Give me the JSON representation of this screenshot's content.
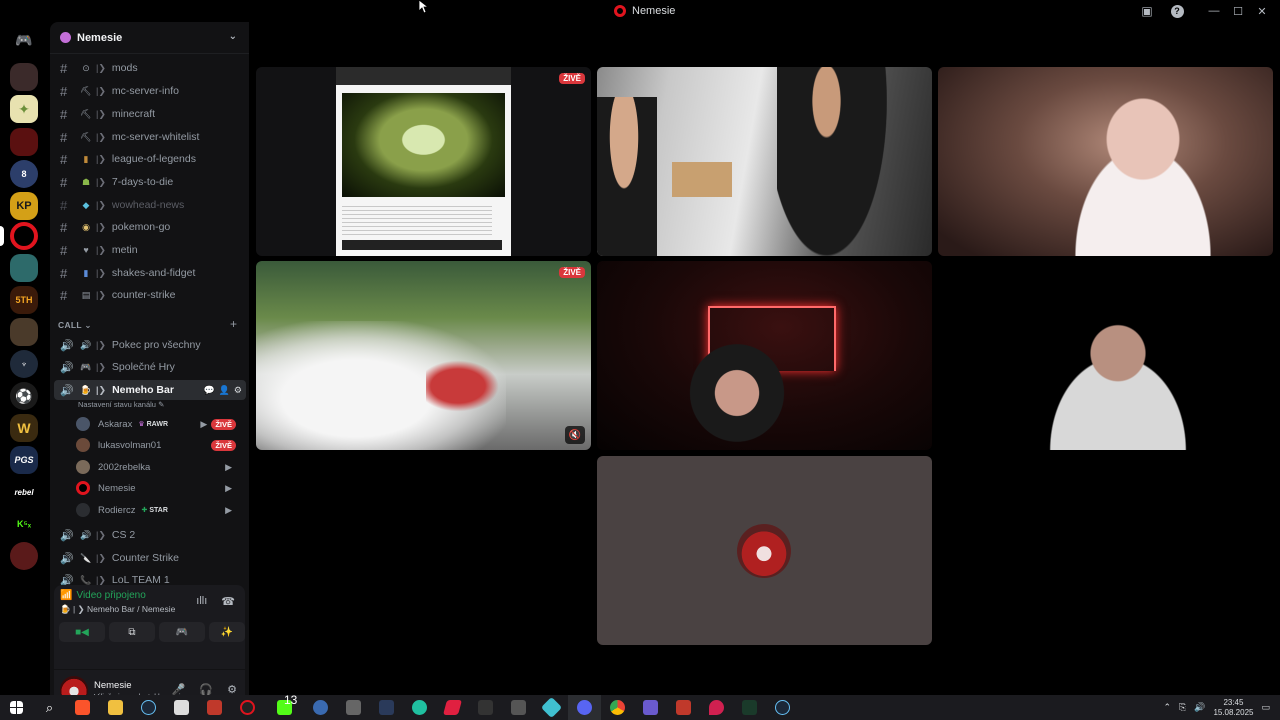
{
  "window": {
    "title": "Nemesie"
  },
  "server": {
    "name": "Nemesie"
  },
  "text_channels": [
    {
      "icon": "⊙",
      "name": "mods"
    },
    {
      "icon": "⛏",
      "name": "mc-server-info"
    },
    {
      "icon": "⛏",
      "name": "minecraft"
    },
    {
      "icon": "⛏",
      "name": "mc-server-whitelist"
    },
    {
      "icon": "▮",
      "name": "league-of-legends"
    },
    {
      "icon": "☗",
      "name": "7-days-to-die"
    },
    {
      "icon": "◆",
      "name": "wowhead-news"
    },
    {
      "icon": "◉",
      "name": "pokemon-go"
    },
    {
      "icon": "♥",
      "name": "metin"
    },
    {
      "icon": "▮",
      "name": "shakes-and-fidget"
    },
    {
      "icon": "▤",
      "name": "counter-strike"
    }
  ],
  "category": {
    "name": "CALL",
    "add": "+"
  },
  "voice_channels_top": [
    {
      "name": "Pokec pro všechny"
    },
    {
      "name": "Společné Hry"
    }
  ],
  "active_voice": {
    "name": "Nemeho Bar",
    "status": "Nastavení stavu kanálu"
  },
  "members": [
    {
      "name": "Askarax",
      "tag": "RAWR",
      "live": "ŽIVĚ",
      "color": "#4a5568"
    },
    {
      "name": "lukasvolman01",
      "tag": "",
      "live": "ŽIVĚ",
      "color": "#6b4a3a"
    },
    {
      "name": "2002rebelka",
      "tag": "",
      "live": "",
      "color": "#7a6a5a"
    },
    {
      "name": "Nemesie",
      "tag": "",
      "live": "",
      "color": "#b91c1c"
    },
    {
      "name": "Rodiercz",
      "tag": "STAR",
      "live": "",
      "color": "#2b2d31"
    }
  ],
  "voice_channels_bottom": [
    {
      "name": "CS 2"
    },
    {
      "name": "Counter Strike"
    },
    {
      "name": "LoL TEAM 1"
    }
  ],
  "voice_panel": {
    "status": "Video připojeno",
    "location": "Nemeho Bar / Nemesie"
  },
  "user": {
    "name": "Nemesie",
    "status": "Vili, že jsem dostal ban a jsem..."
  },
  "tiles": [
    {
      "live": "ŽIVĚ"
    },
    {
      "live": "ŽIVĚ"
    }
  ],
  "taskbar": {
    "badge": "13",
    "time": "23:45",
    "date": "15.08.2025"
  },
  "colors": {
    "accent": "#5865f2",
    "live": "#da373c",
    "connected": "#23a55a",
    "opera": "#e0141e"
  }
}
